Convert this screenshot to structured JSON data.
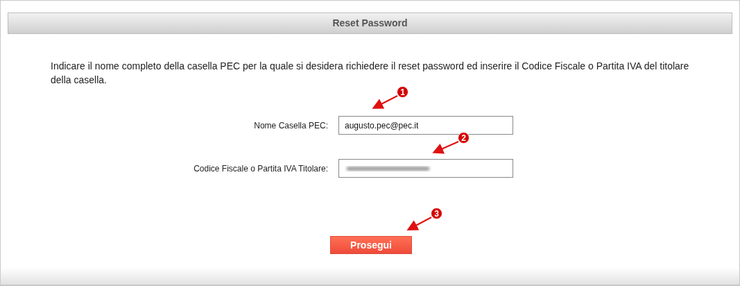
{
  "header": {
    "title": "Reset Password"
  },
  "instructions": "Indicare il nome completo della casella PEC per la quale si desidera richiedere il reset password ed inserire il Codice Fiscale o Partita IVA del titolare della casella.",
  "fields": [
    {
      "label": "Nome Casella PEC:",
      "value": "augusto.pec@pec.it",
      "blurred": false
    },
    {
      "label": "Codice Fiscale o Partita IVA Titolare:",
      "blurred": true
    }
  ],
  "submit_button": "Prosegui",
  "annotations": [
    {
      "number": "1"
    },
    {
      "number": "2"
    },
    {
      "number": "3"
    }
  ]
}
